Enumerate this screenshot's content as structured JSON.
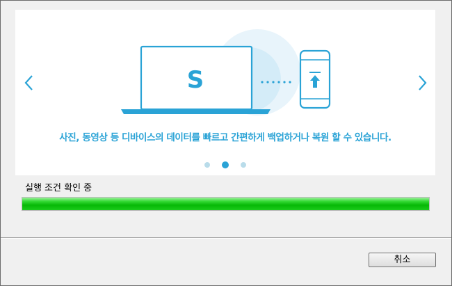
{
  "carousel": {
    "caption": "사진, 동영상 등 디바이스의 데이터를 빠르고 간편하게 백업하거나 복원 할 수 있습니다.",
    "laptop_logo": "S",
    "slide_count": 3,
    "active_slide": 2,
    "accent_color": "#2aa3d6",
    "prev_icon": "chevron-left-icon",
    "next_icon": "chevron-right-icon"
  },
  "status": {
    "label": "실행 조건 확인 중",
    "progress_percent": 100,
    "progress_color": "#22c522"
  },
  "footer": {
    "cancel_label": "취소"
  }
}
